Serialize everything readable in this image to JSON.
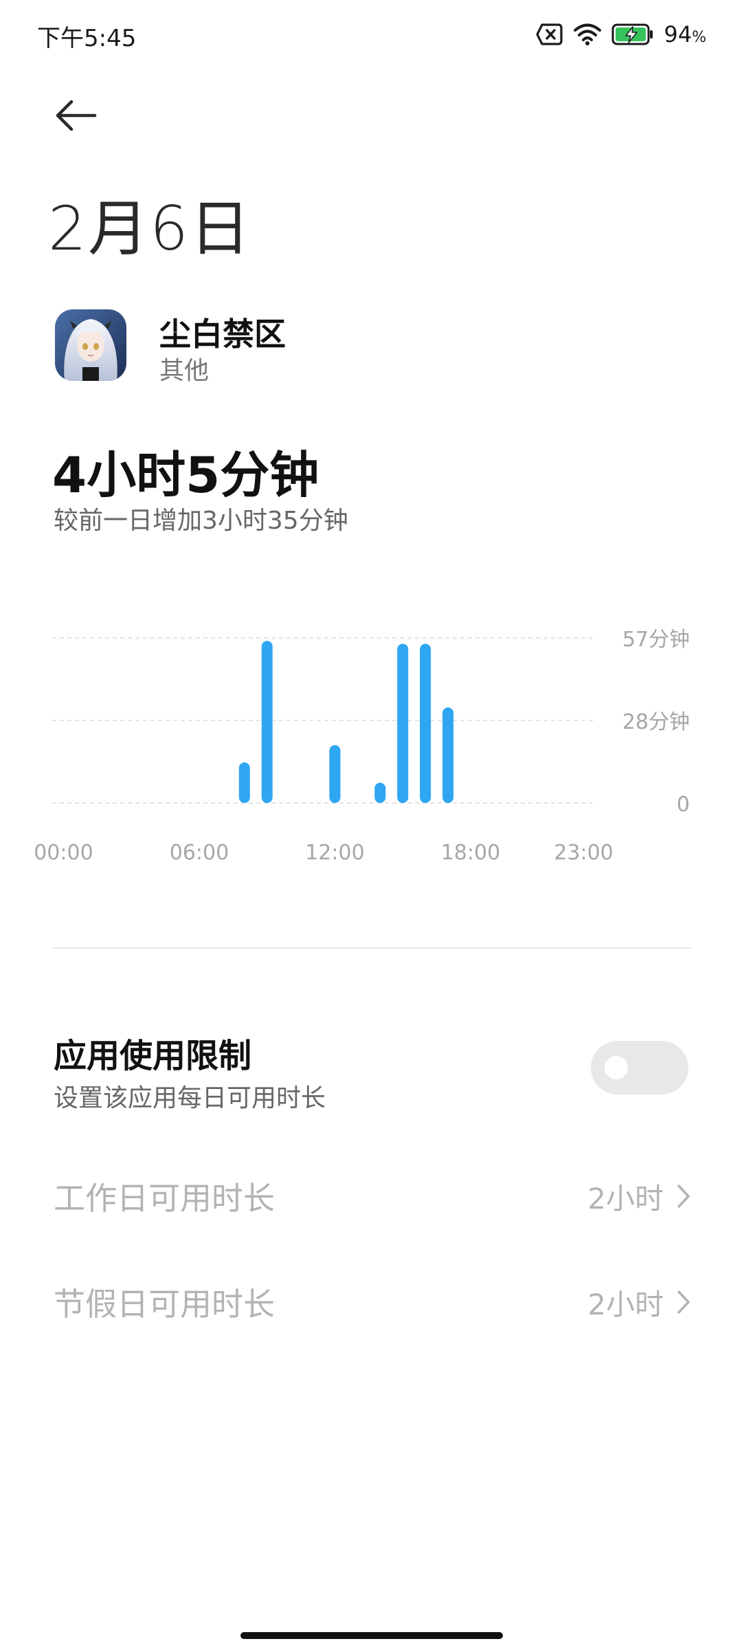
{
  "status_bar": {
    "time": "下午5:45",
    "battery_percent": "94",
    "battery_symbol": "%",
    "icons": [
      "sim-off-icon",
      "wifi-icon",
      "battery-charging-icon"
    ]
  },
  "header": {
    "back_icon": "arrow-left-icon",
    "title": "2月6日"
  },
  "app": {
    "name": "尘白禁区",
    "category": "其他",
    "icon": "app-icon-anime-character"
  },
  "usage": {
    "total": "4小时5分钟",
    "compare": "较前一日增加3小时35分钟"
  },
  "chart_data": {
    "type": "bar",
    "x_tick_labels": [
      "00:00",
      "06:00",
      "12:00",
      "18:00",
      "23:00"
    ],
    "y_tick_labels": [
      "57分钟",
      "28分钟",
      "0"
    ],
    "ylim": [
      0,
      57
    ],
    "y_unit": "分钟",
    "grid": true,
    "color": "#2EA6F2",
    "categories": [
      "00:00",
      "01:00",
      "02:00",
      "03:00",
      "04:00",
      "05:00",
      "06:00",
      "07:00",
      "08:00",
      "09:00",
      "10:00",
      "11:00",
      "12:00",
      "13:00",
      "14:00",
      "15:00",
      "16:00",
      "17:00",
      "18:00",
      "19:00",
      "20:00",
      "21:00",
      "22:00",
      "23:00"
    ],
    "values": [
      0,
      0,
      0,
      0,
      0,
      0,
      0,
      0,
      14,
      56,
      0,
      0,
      20,
      0,
      7,
      55,
      55,
      33,
      0,
      0,
      0,
      0,
      0,
      0
    ]
  },
  "limit": {
    "title": "应用使用限制",
    "description": "设置该应用每日可用时长",
    "enabled": false
  },
  "settings": [
    {
      "label": "工作日可用时长",
      "value": "2小时"
    },
    {
      "label": "节假日可用时长",
      "value": "2小时"
    }
  ]
}
